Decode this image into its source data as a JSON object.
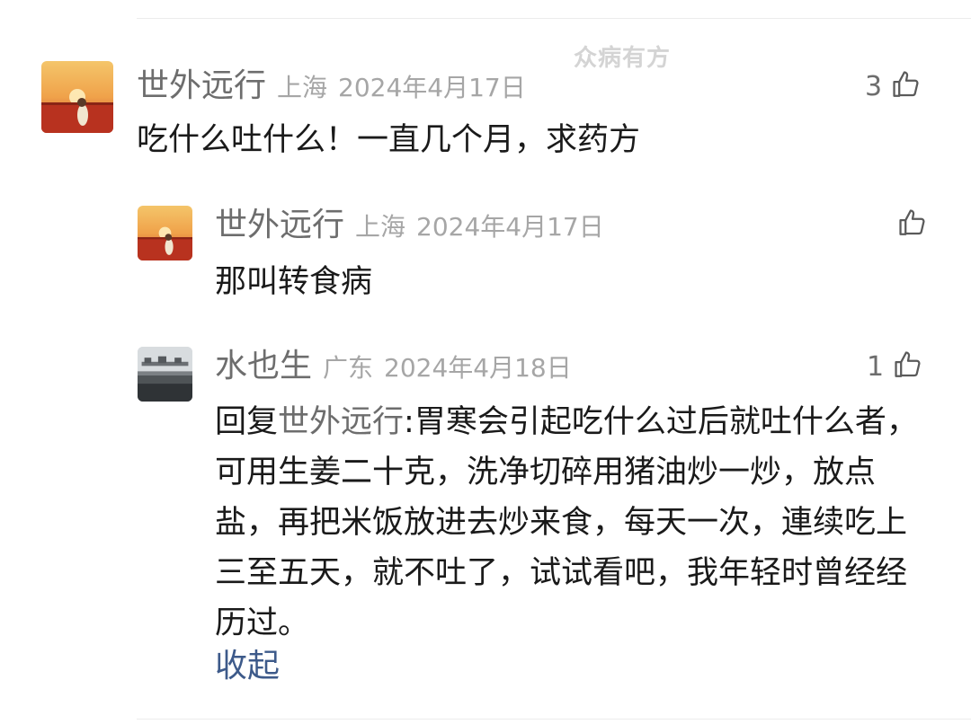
{
  "watermark": "众病有方",
  "comments": [
    {
      "author": "世外远行",
      "location": "上海",
      "date": "2024年4月17日",
      "likes": "3",
      "text": "吃什么吐什么！一直几个月，求药方"
    },
    {
      "author": "世外远行",
      "location": "上海",
      "date": "2024年4月17日",
      "likes": "",
      "text": "那叫转食病"
    },
    {
      "author": "水也生",
      "location": "广东",
      "date": "2024年4月18日",
      "likes": "1",
      "reply_prefix": "回复",
      "reply_to": "世外远行",
      "text": ":胃寒会引起吃什么过后就吐什么者，可用生姜二十克，洗净切碎用猪油炒一炒，放点盐，再把米饭放进去炒来食，每天一次，連续吃上三至五天，就不吐了，试试看吧，我年轻时曾经经历过。",
      "collapse_label": "收起"
    }
  ]
}
